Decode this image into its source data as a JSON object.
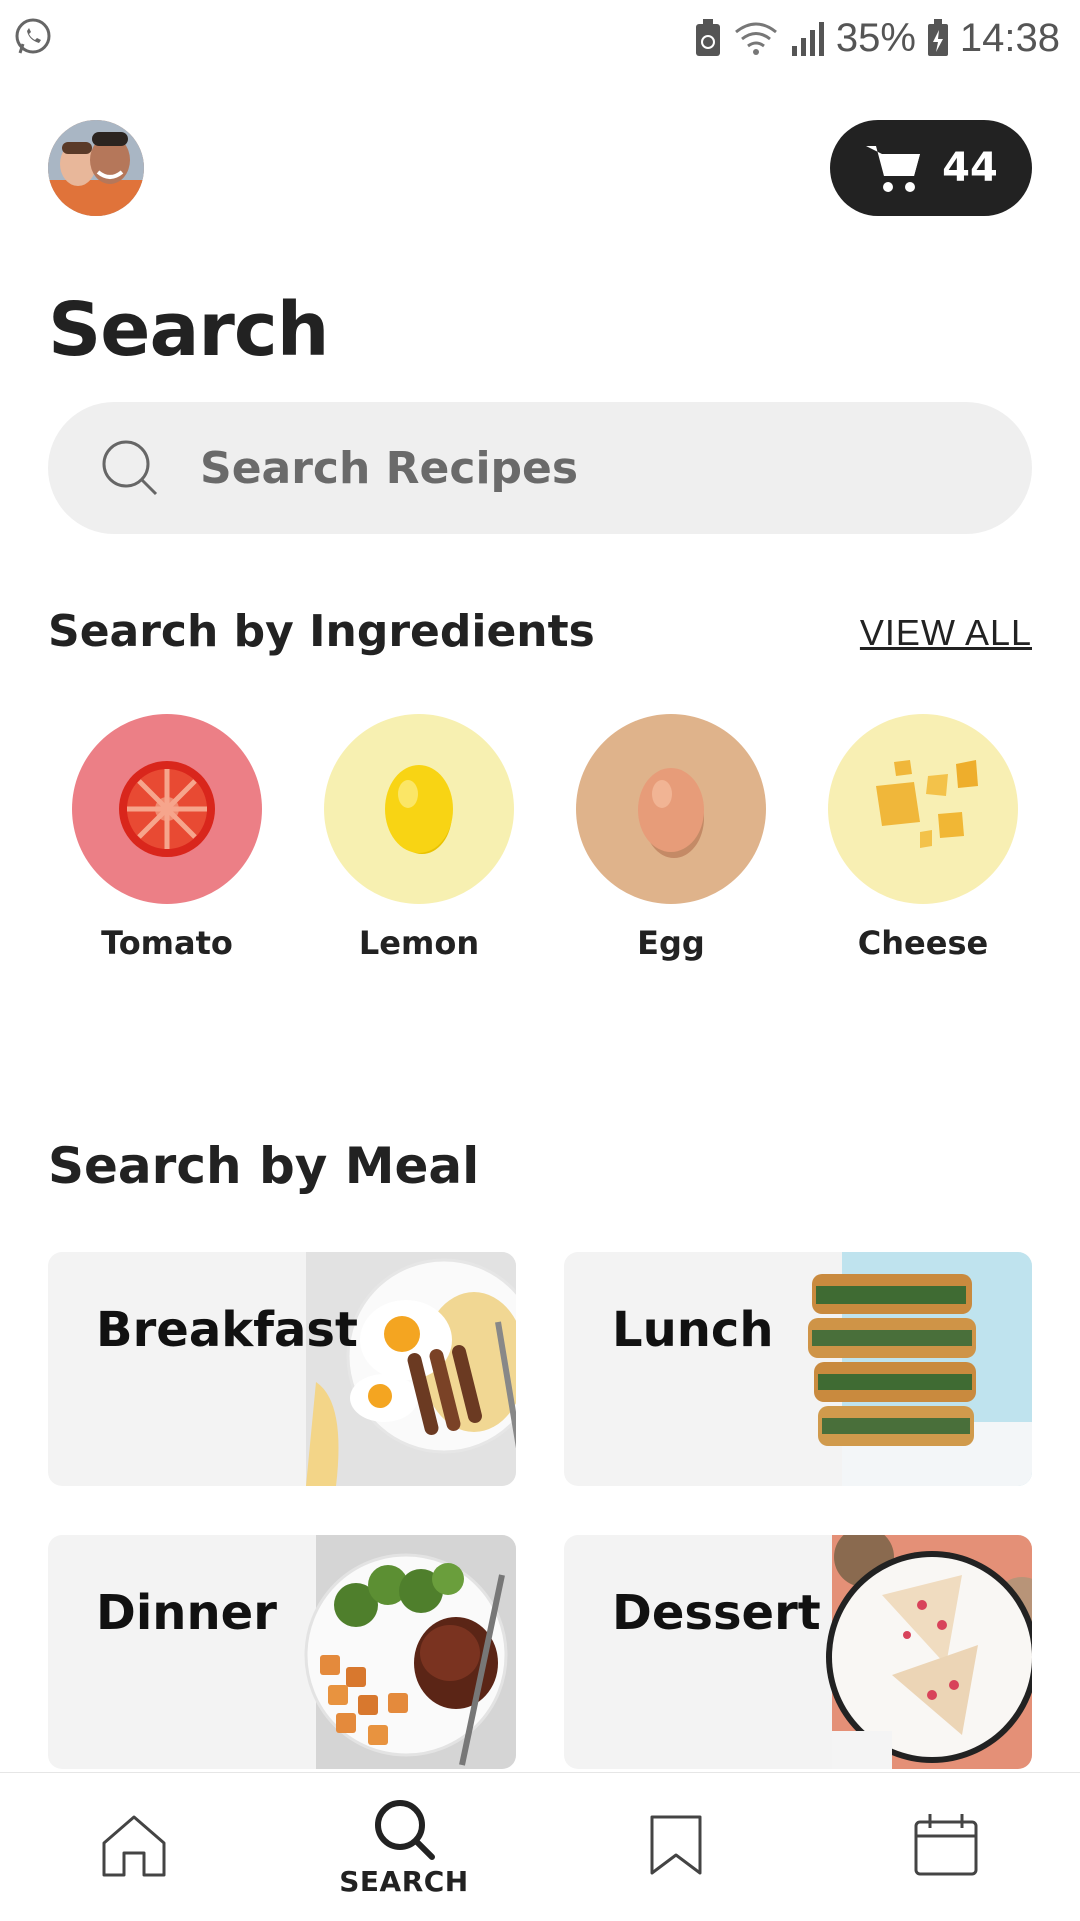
{
  "status_bar": {
    "battery": "35%",
    "time": "14:38"
  },
  "header": {
    "cart_count": "44"
  },
  "page": {
    "title": "Search"
  },
  "search": {
    "placeholder": "Search Recipes"
  },
  "ingredients": {
    "title": "Search by Ingredients",
    "view_all": "VIEW ALL",
    "items": [
      {
        "label": "Tomato",
        "color": "#ec7f86"
      },
      {
        "label": "Lemon",
        "color": "#f7f0b1"
      },
      {
        "label": "Egg",
        "color": "#dfb38b"
      },
      {
        "label": "Cheese",
        "color": "#f8efb3"
      }
    ]
  },
  "meals": {
    "title": "Search by Meal",
    "items": [
      {
        "label": "Breakfast"
      },
      {
        "label": "Lunch"
      },
      {
        "label": "Dinner"
      },
      {
        "label": "Dessert"
      }
    ]
  },
  "bottom_nav": {
    "items": [
      {
        "icon": "home-icon",
        "label": ""
      },
      {
        "icon": "search-icon",
        "label": "SEARCH"
      },
      {
        "icon": "bookmark-icon",
        "label": ""
      },
      {
        "icon": "calendar-icon",
        "label": ""
      }
    ]
  }
}
